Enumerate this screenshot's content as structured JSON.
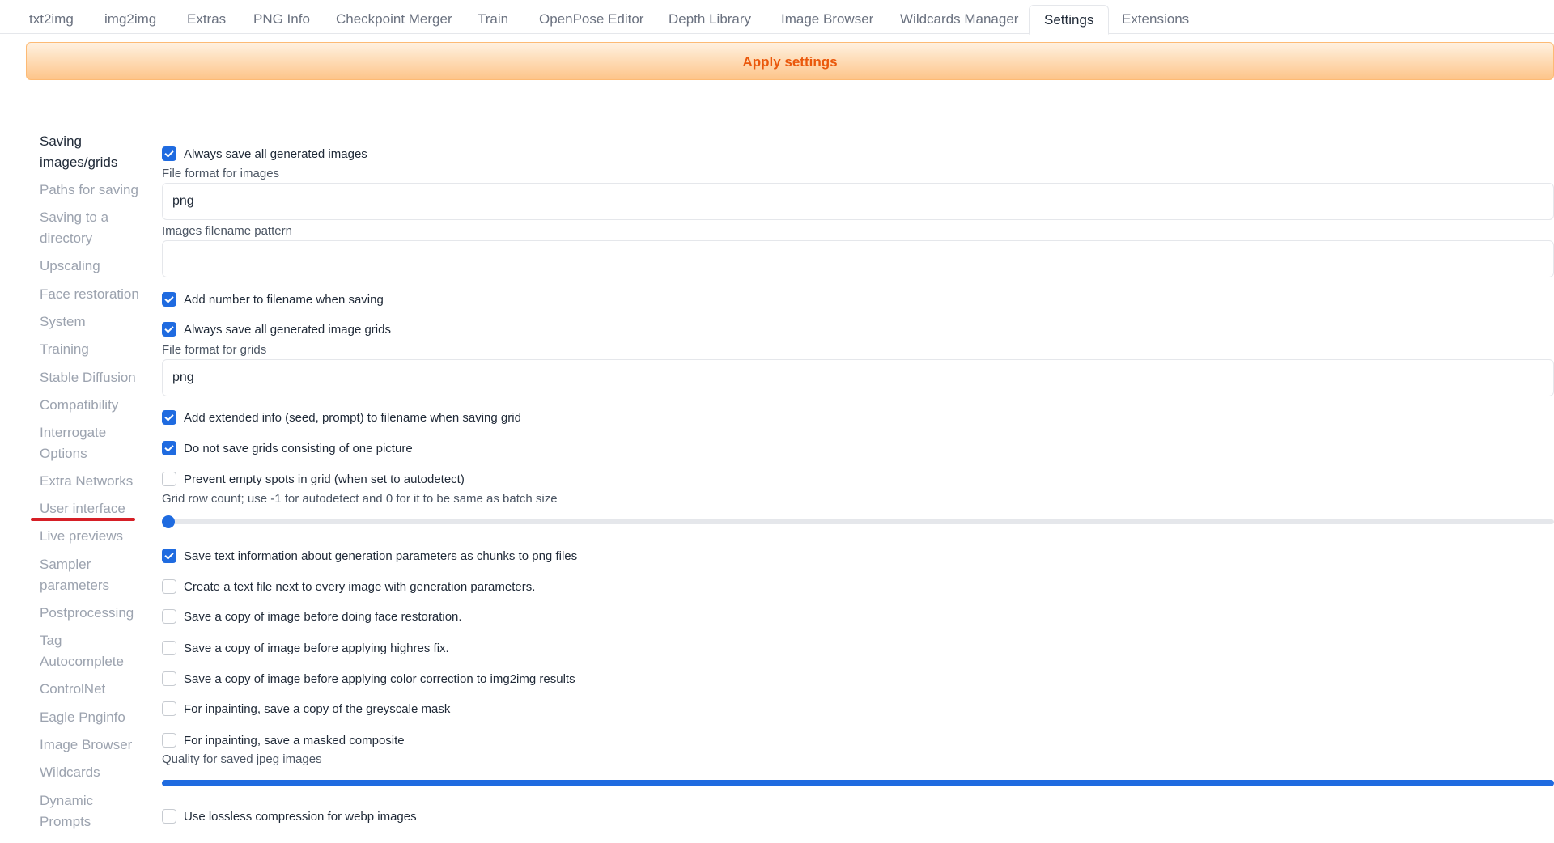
{
  "tabs": [
    "txt2img",
    "img2img",
    "Extras",
    "PNG Info",
    "Checkpoint Merger",
    "Train",
    "OpenPose Editor",
    "Depth Library",
    "Image Browser",
    "Wildcards Manager",
    "Settings",
    "Extensions"
  ],
  "active_tab": "Settings",
  "apply_label": "Apply settings",
  "sidebar": [
    "Saving images/grids",
    "Paths for saving",
    "Saving to a directory",
    "Upscaling",
    "Face restoration",
    "System",
    "Training",
    "Stable Diffusion",
    "Compatibility",
    "Interrogate Options",
    "Extra Networks",
    "User interface",
    "Live previews",
    "Sampler parameters",
    "Postprocessing",
    "Tag Autocomplete",
    "ControlNet",
    "Eagle Pnginfo",
    "Image Browser",
    "Wildcards",
    "Dynamic Prompts"
  ],
  "settings": {
    "always_save_images": {
      "label": "Always save all generated images",
      "checked": true
    },
    "file_format_images": {
      "label": "File format for images",
      "value": "png"
    },
    "filename_pattern": {
      "label": "Images filename pattern",
      "value": ""
    },
    "add_number": {
      "label": "Add number to filename when saving",
      "checked": true
    },
    "always_save_grids": {
      "label": "Always save all generated image grids",
      "checked": true
    },
    "file_format_grids": {
      "label": "File format for grids",
      "value": "png"
    },
    "extended_info": {
      "label": "Add extended info (seed, prompt) to filename when saving grid",
      "checked": true
    },
    "no_single_grid": {
      "label": "Do not save grids consisting of one picture",
      "checked": true
    },
    "prevent_empty": {
      "label": "Prevent empty spots in grid (when set to autodetect)",
      "checked": false
    },
    "grid_row_count": {
      "label": "Grid row count; use -1 for autodetect and 0 for it to be same as batch size",
      "fraction": 0
    },
    "save_text_info": {
      "label": "Save text information about generation parameters as chunks to png files",
      "checked": true
    },
    "create_text_file": {
      "label": "Create a text file next to every image with generation parameters.",
      "checked": false
    },
    "copy_before_face": {
      "label": "Save a copy of image before doing face restoration.",
      "checked": false
    },
    "copy_before_highres": {
      "label": "Save a copy of image before applying highres fix.",
      "checked": false
    },
    "copy_before_color": {
      "label": "Save a copy of image before applying color correction to img2img results",
      "checked": false
    },
    "inpaint_mask": {
      "label": "For inpainting, save a copy of the greyscale mask",
      "checked": false
    },
    "inpaint_composite": {
      "label": "For inpainting, save a masked composite",
      "checked": false
    },
    "jpeg_quality": {
      "label": "Quality for saved jpeg images",
      "fraction": 1
    },
    "webp_lossless": {
      "label": "Use lossless compression for webp images",
      "checked": false
    }
  },
  "colors": {
    "accent": "#1f6be0",
    "apply_text": "#ea580c",
    "annotation": "#d61f26"
  }
}
